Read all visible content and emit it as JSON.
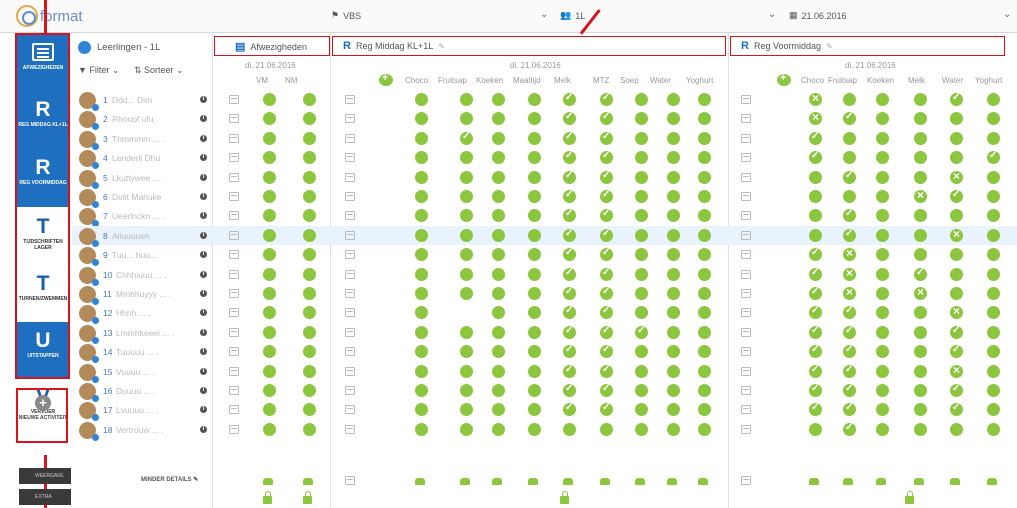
{
  "logo": {
    "text": "format"
  },
  "topbar": {
    "school": "VBS",
    "group": "1L",
    "date": "21.06.2016"
  },
  "sidebar": {
    "items": [
      {
        "letter": "",
        "label": "AFWEZIGHEDEN"
      },
      {
        "letter": "R",
        "label": "REG MIDDAG KL+1L"
      },
      {
        "letter": "R",
        "label": "REG VOORMIDDAG"
      },
      {
        "letter": "T",
        "label": "TIJDSCHRIFTEN LAGER"
      },
      {
        "letter": "T",
        "label": "TURNEN/ZWEMMEN"
      },
      {
        "letter": "U",
        "label": "UITSTAPPEN"
      },
      {
        "letter": "V",
        "label": "VERVOER"
      }
    ],
    "new_activity": "NIEUWE ACTIVITEIT",
    "bottom": [
      "WEERGAVE",
      "EXTRA"
    ]
  },
  "panel": {
    "title": "Leerlingen - 1L",
    "filter": "Filter",
    "sort": "Sorteer",
    "less_details": "MINDER DETAILS"
  },
  "students": [
    {
      "num": "1",
      "name": "Ddd... Dim"
    },
    {
      "num": "2",
      "name": "Rhooof ufu."
    },
    {
      "num": "3",
      "name": "Thmmmm ... ."
    },
    {
      "num": "4",
      "name": "Lenderli Dhu"
    },
    {
      "num": "5",
      "name": "Lkuttywee ... ."
    },
    {
      "num": "6",
      "name": "Dulit Mahuke"
    },
    {
      "num": "7",
      "name": "Ueerlnckn ... ."
    },
    {
      "num": "8",
      "name": "Ailuuuueh"
    },
    {
      "num": "9",
      "name": "Tuu... huu..."
    },
    {
      "num": "10",
      "name": "Chhhiuuu ... ."
    },
    {
      "num": "11",
      "name": "Mmhhuyyy ... ."
    },
    {
      "num": "12",
      "name": "Hhhh ... ."
    },
    {
      "num": "13",
      "name": "Lmmhkeeei ... ."
    },
    {
      "num": "14",
      "name": "Tuuuuu ... ."
    },
    {
      "num": "15",
      "name": "Vuuuu ... ."
    },
    {
      "num": "16",
      "name": "Duuuu ... ."
    },
    {
      "num": "17",
      "name": "Lvuuuu ... ."
    },
    {
      "num": "18",
      "name": "Vertrouw ... ."
    }
  ],
  "sections": [
    {
      "title": "Afwezigheden",
      "date": "di. 21.06.2016",
      "cols": [
        "VM",
        "NM"
      ]
    },
    {
      "title": "Reg Middag KL+1L",
      "date": "di. 21.06.2016",
      "cols": [
        "Choco",
        "Fruitsap",
        "Koeken",
        "Maaltijd",
        "Melk",
        "MTZ",
        "Soep",
        "Water",
        "Yoghurt"
      ]
    },
    {
      "title": "Reg Voormiddag",
      "date": "di. 21.06.2016",
      "cols": [
        "Choco",
        "Fruitsap",
        "Koeken",
        "Melk",
        "Water",
        "Yoghurt"
      ]
    }
  ],
  "colors": {
    "accent": "#1f6fc0",
    "green": "#8cc63f",
    "red": "#d9131e"
  }
}
